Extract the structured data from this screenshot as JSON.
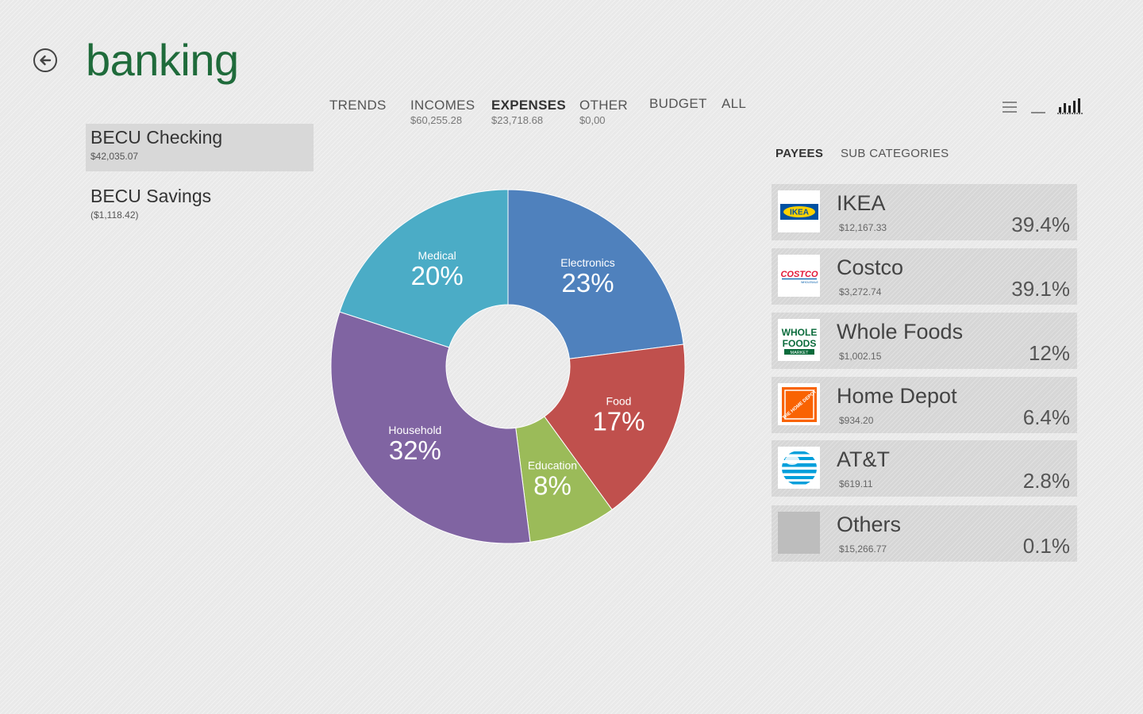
{
  "app": {
    "title": "banking"
  },
  "tabs": [
    {
      "label": "TRENDS",
      "amount": ""
    },
    {
      "label": "INCOMES",
      "amount": "$60,255.28"
    },
    {
      "label": "EXPENSES",
      "amount": "$23,718.68"
    },
    {
      "label": "OTHER",
      "amount": "$0,00"
    },
    {
      "label": "BUDGET",
      "amount": ""
    },
    {
      "label": "ALL",
      "amount": ""
    }
  ],
  "view_icons": [
    "list-view-icon",
    "line-view-icon",
    "bar-chart-view-icon"
  ],
  "accounts": [
    {
      "name": "BECU Checking",
      "balance": "$42,035.07",
      "selected": true
    },
    {
      "name": "BECU Savings",
      "balance": "($1,118.42)",
      "selected": false
    }
  ],
  "subtabs": [
    {
      "label": "PAYEES",
      "active": true
    },
    {
      "label": "SUB CATEGORIES",
      "active": false
    }
  ],
  "payees": [
    {
      "name": "IKEA",
      "amount": "$12,167.33",
      "percent": "39.4%",
      "logo_text": "IKEA",
      "icon": "ikea-logo-icon"
    },
    {
      "name": "Costco",
      "amount": "$3,272.74",
      "percent": "39.1%",
      "logo_text": "COSTCO",
      "logo_subtext": "WHOLESALE",
      "icon": "costco-logo-icon"
    },
    {
      "name": "Whole Foods",
      "amount": "$1,002.15",
      "percent": "12%",
      "logo_text": "WHOLE",
      "logo_text2": "FOODS",
      "logo_subtext": "MARKET",
      "icon": "whole-foods-logo-icon"
    },
    {
      "name": "Home Depot",
      "amount": "$934.20",
      "percent": "6.4%",
      "logo_text": "THE HOME DEPOT",
      "icon": "home-depot-logo-icon"
    },
    {
      "name": "AT&T",
      "amount": "$619.11",
      "percent": "2.8%",
      "icon": "att-logo-icon"
    },
    {
      "name": "Others",
      "amount": "$15,266.77",
      "percent": "0.1%",
      "icon": "others-placeholder-icon"
    }
  ],
  "chart_data": {
    "type": "pie",
    "slices": [
      {
        "label": "Electronics",
        "value": 23,
        "display": "23%",
        "color": "#4f81bd"
      },
      {
        "label": "Food",
        "value": 17,
        "display": "17%",
        "color": "#c0504d"
      },
      {
        "label": "Education",
        "value": 8,
        "display": "8%",
        "color": "#9bbb59"
      },
      {
        "label": "Household",
        "value": 32,
        "display": "32%",
        "color": "#8064a2"
      },
      {
        "label": "Medical",
        "value": 20,
        "display": "20%",
        "color": "#4bacc6"
      }
    ]
  },
  "colors": {
    "accent": "#1f6b3b"
  }
}
